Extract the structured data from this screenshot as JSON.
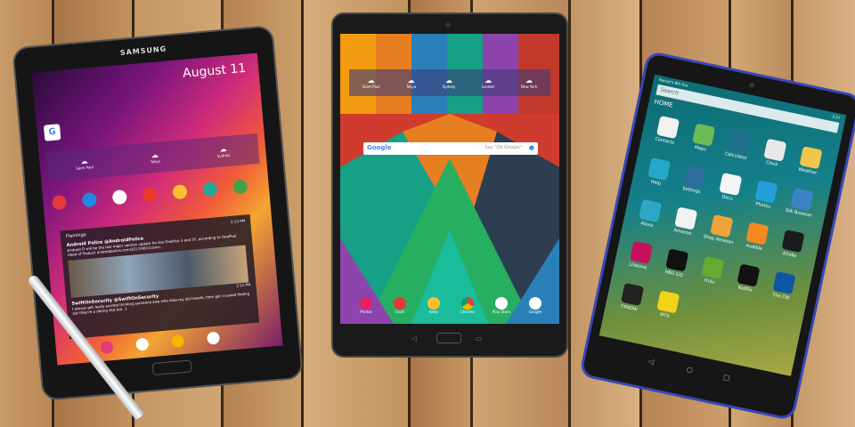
{
  "samsung": {
    "brand": "SAMSUNG",
    "date": "August 11",
    "weather": [
      {
        "city": "Saint Paul"
      },
      {
        "city": "Tokyo"
      },
      {
        "city": "Sydney"
      }
    ],
    "card_title": "Flamingo",
    "tweet1_author": "Android Police @AndroidPolice",
    "tweet1_text": "Android O will be the last major version update for the OnePlus 3 and 3T, according to OnePlus' Head of Product androidpolice.com/2017/08/11/and...",
    "tweet1_time": "2:13 PM",
    "tweet2_author": "SwiftOnSecurity @SwiftOnSecurity",
    "tweet2_text": "I always get really excited thinking someone else who likes my old tweets, then get crushed finding out they're a dating site bot. :(",
    "tweet2_time": "2:12 PM"
  },
  "asus": {
    "weather": [
      {
        "city": "Saint Paul"
      },
      {
        "city": "Tokyo"
      },
      {
        "city": "Sydney"
      },
      {
        "city": "London"
      },
      {
        "city": "New York"
      }
    ],
    "search_brand": "Google",
    "search_hint": "Say \"Ok Google\"",
    "dock": [
      {
        "label": "Photos"
      },
      {
        "label": "Clock"
      },
      {
        "label": "Keep"
      },
      {
        "label": "Chrome"
      },
      {
        "label": "Play Store"
      },
      {
        "label": "Google"
      }
    ]
  },
  "fire": {
    "owner": "Rachel's 8th Fire",
    "search": "Search",
    "home_label": "HOME",
    "clock": "2:27",
    "apps": [
      {
        "label": "Contacts",
        "color": "#f2f2f2"
      },
      {
        "label": "Maps",
        "color": "#6dbb55"
      },
      {
        "label": "Calculator",
        "color": "#1f6f8b"
      },
      {
        "label": "Clock",
        "color": "#e8e8e8"
      },
      {
        "label": "Weather",
        "color": "#f0c64a"
      },
      {
        "label": "Help",
        "color": "#25a7c9"
      },
      {
        "label": "Settings",
        "color": "#2d6e9e"
      },
      {
        "label": "Docs",
        "color": "#f4f4f4"
      },
      {
        "label": "Photos",
        "color": "#24a0d8"
      },
      {
        "label": "Silk Browser",
        "color": "#3b84c4"
      },
      {
        "label": "Alexa",
        "color": "#2ea6c8"
      },
      {
        "label": "Amazon",
        "color": "#f2f2f2"
      },
      {
        "label": "Shop Amazon",
        "color": "#f1a33b"
      },
      {
        "label": "Audible",
        "color": "#f48a1f"
      },
      {
        "label": "Kindle",
        "color": "#1b1b1b"
      },
      {
        "label": "Lifetime",
        "color": "#c7105d"
      },
      {
        "label": "HBO GO",
        "color": "#111111"
      },
      {
        "label": "Hulu",
        "color": "#66aa33"
      },
      {
        "label": "Netflix",
        "color": "#111111"
      },
      {
        "label": "The CW",
        "color": "#0e57a6"
      },
      {
        "label": "FXNOW",
        "color": "#222222"
      },
      {
        "label": "MTV",
        "color": "#f2d21a"
      }
    ]
  }
}
